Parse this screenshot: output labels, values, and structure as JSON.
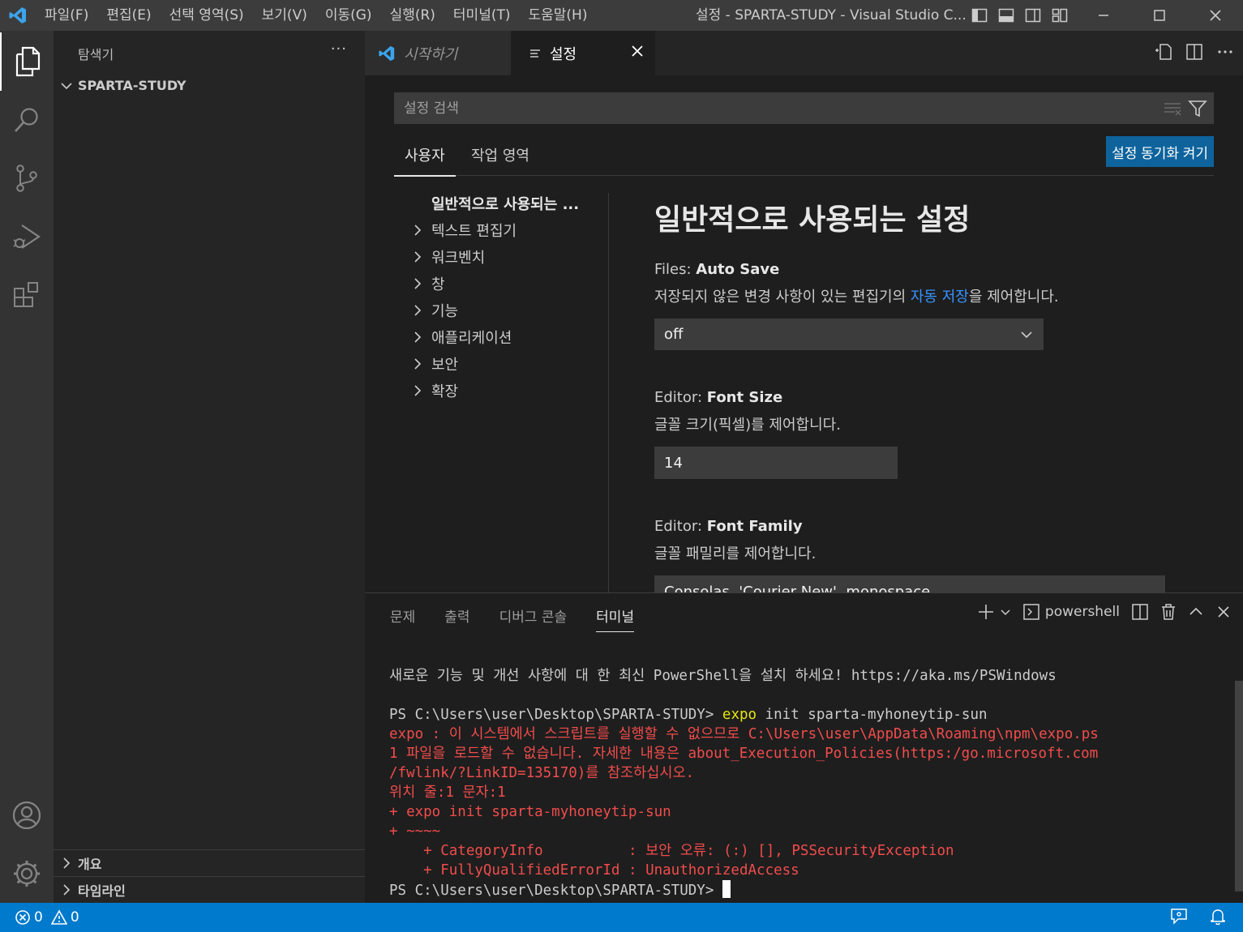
{
  "titlebar": {
    "menus": [
      "파일(F)",
      "편집(E)",
      "선택 영역(S)",
      "보기(V)",
      "이동(G)",
      "실행(R)",
      "터미널(T)",
      "도움말(H)"
    ],
    "window_title": "설정 - SPARTA-STUDY - Visual Studio C..."
  },
  "sidebar": {
    "title": "탐색기",
    "more": "···",
    "folder": "SPARTA-STUDY",
    "sections": [
      "개요",
      "타임라인"
    ]
  },
  "tabs": {
    "start": "시작하기",
    "settings": "설정"
  },
  "settings": {
    "search_placeholder": "설정 검색",
    "scope_user": "사용자",
    "scope_workspace": "작업 영역",
    "sync_button": "설정 동기화 켜기",
    "toc": {
      "top": "일반적으로 사용되는 ...",
      "items": [
        "텍스트 편집기",
        "워크벤치",
        "창",
        "기능",
        "애플리케이션",
        "보안",
        "확장"
      ]
    },
    "section_title": "일반적으로 사용되는 설정",
    "items": [
      {
        "category": "Files: ",
        "name": "Auto Save",
        "desc_pre": "저장되지 않은 변경 사항이 있는 편집기의 ",
        "desc_link": "자동 저장",
        "desc_post": "을 제어합니다.",
        "value": "off"
      },
      {
        "category": "Editor: ",
        "name": "Font Size",
        "desc": "글꼴 크기(픽셀)를 제어합니다.",
        "value": "14"
      },
      {
        "category": "Editor: ",
        "name": "Font Family",
        "desc": "글꼴 패밀리를 제어합니다.",
        "value": "Consolas, 'Courier New', monospace"
      }
    ]
  },
  "panel": {
    "tabs": [
      "문제",
      "출력",
      "디버그 콘솔",
      "터미널"
    ],
    "active_tab": "터미널",
    "shell": "powershell"
  },
  "terminal": {
    "line1": "새로운 기능 및 개선 사항에 대 한 최신 PowerShell을 설치 하세요! https://aka.ms/PSWindows",
    "prompt1": "PS C:\\Users\\user\\Desktop\\SPARTA-STUDY> ",
    "command": "expo",
    "command_args": " init sparta-myhoneytip-sun",
    "err1": "expo : 이 시스템에서 스크립트를 실행할 수 없으므로 C:\\Users\\user\\AppData\\Roaming\\npm\\expo.ps",
    "err2": "1 파일을 로드할 수 없습니다. 자세한 내용은 about_Execution_Policies(https:/go.microsoft.com",
    "err3": "/fwlink/?LinkID=135170)를 참조하십시오.",
    "err4": "위치 줄:1 문자:1",
    "err5": "+ expo init sparta-myhoneytip-sun",
    "err6": "+ ~~~~",
    "err7": "    + CategoryInfo          : 보안 오류: (:) [], PSSecurityException",
    "err8": "    + FullyQualifiedErrorId : UnauthorizedAccess",
    "prompt2": "PS C:\\Users\\user\\Desktop\\SPARTA-STUDY> "
  },
  "statusbar": {
    "errors": "0",
    "warnings": "0"
  },
  "colors": {
    "accent": "#007acc",
    "error_text": "#f14c4c",
    "link": "#3794ff",
    "sync_button": "#0e639c"
  }
}
